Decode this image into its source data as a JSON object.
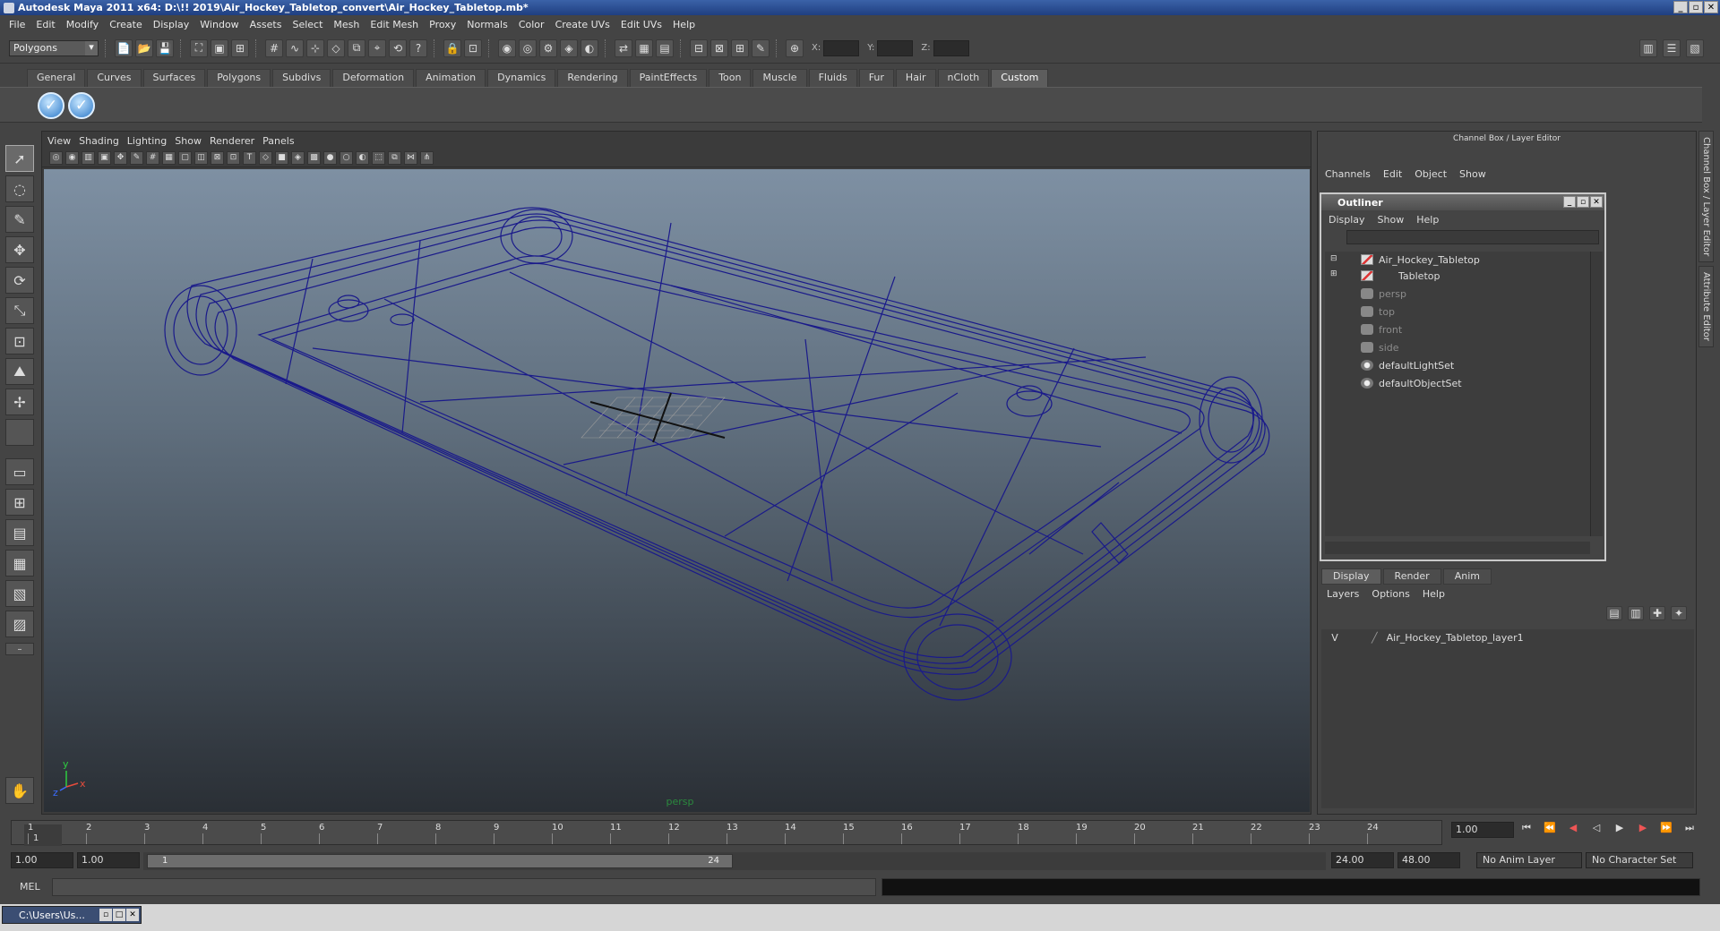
{
  "window": {
    "title": "Autodesk Maya 2011 x64: D:\\!! 2019\\Air_Hockey_Tabletop_convert\\Air_Hockey_Tabletop.mb*",
    "controls": [
      "_",
      "▫",
      "✕"
    ]
  },
  "menubar": [
    "File",
    "Edit",
    "Modify",
    "Create",
    "Display",
    "Window",
    "Assets",
    "Select",
    "Mesh",
    "Edit Mesh",
    "Proxy",
    "Normals",
    "Color",
    "Create UVs",
    "Edit UVs",
    "Help"
  ],
  "statusline": {
    "mode": "Polygons",
    "coord_labels": [
      "X:",
      "Y:",
      "Z:"
    ]
  },
  "shelf": {
    "tabs": [
      "General",
      "Curves",
      "Surfaces",
      "Polygons",
      "Subdivs",
      "Deformation",
      "Animation",
      "Dynamics",
      "Rendering",
      "PaintEffects",
      "Toon",
      "Muscle",
      "Fluids",
      "Fur",
      "Hair",
      "nCloth",
      "Custom"
    ],
    "active_tab": "Custom",
    "buttons": [
      "✓",
      "✓"
    ]
  },
  "viewport": {
    "menu": [
      "View",
      "Shading",
      "Lighting",
      "Show",
      "Renderer",
      "Panels"
    ],
    "camera_label": "persp",
    "wire_color": "#1a1a8a",
    "axis": {
      "y": "y",
      "x": "x",
      "z": "z"
    }
  },
  "channel_box": {
    "title": "Channel Box / Layer Editor",
    "menu": [
      "Channels",
      "Edit",
      "Object",
      "Show"
    ]
  },
  "outliner": {
    "title": "Outliner",
    "menu": [
      "Display",
      "Show",
      "Help"
    ],
    "items": [
      {
        "label": "Air_Hockey_Tabletop",
        "icon": "transform-icon",
        "dim": false
      },
      {
        "label": "Tabletop",
        "icon": "transform-icon",
        "dim": false
      },
      {
        "label": "persp",
        "icon": "camera-icon",
        "dim": true
      },
      {
        "label": "top",
        "icon": "camera-icon",
        "dim": true
      },
      {
        "label": "front",
        "icon": "camera-icon",
        "dim": true
      },
      {
        "label": "side",
        "icon": "camera-icon",
        "dim": true
      },
      {
        "label": "defaultLightSet",
        "icon": "set-icon",
        "dim": false
      },
      {
        "label": "defaultObjectSet",
        "icon": "set-icon",
        "dim": false
      }
    ]
  },
  "layer_editor": {
    "tabs": [
      "Display",
      "Render",
      "Anim"
    ],
    "active_tab": "Display",
    "menu": [
      "Layers",
      "Options",
      "Help"
    ],
    "layers": [
      {
        "visible": "V",
        "name": "Air_Hockey_Tabletop_layer1"
      }
    ]
  },
  "side_tabs": [
    "Channel Box / Layer Editor",
    "Attribute Editor"
  ],
  "timeline": {
    "ticks": [
      "1",
      "2",
      "3",
      "4",
      "5",
      "6",
      "7",
      "8",
      "9",
      "10",
      "11",
      "12",
      "13",
      "14",
      "15",
      "16",
      "17",
      "18",
      "19",
      "20",
      "21",
      "22",
      "23",
      "24"
    ],
    "current_frame_label": "1",
    "current_time": "1.00"
  },
  "range": {
    "start_time": "1.00",
    "playback_start": "1.00",
    "bar_start": "1",
    "bar_end": "24",
    "playback_end": "24.00",
    "end_time": "48.00",
    "anim_layer": "No Anim Layer",
    "character_set": "No Character Set"
  },
  "command_line": {
    "label": "MEL"
  },
  "taskbar": {
    "item": "C:\\Users\\Us..."
  }
}
